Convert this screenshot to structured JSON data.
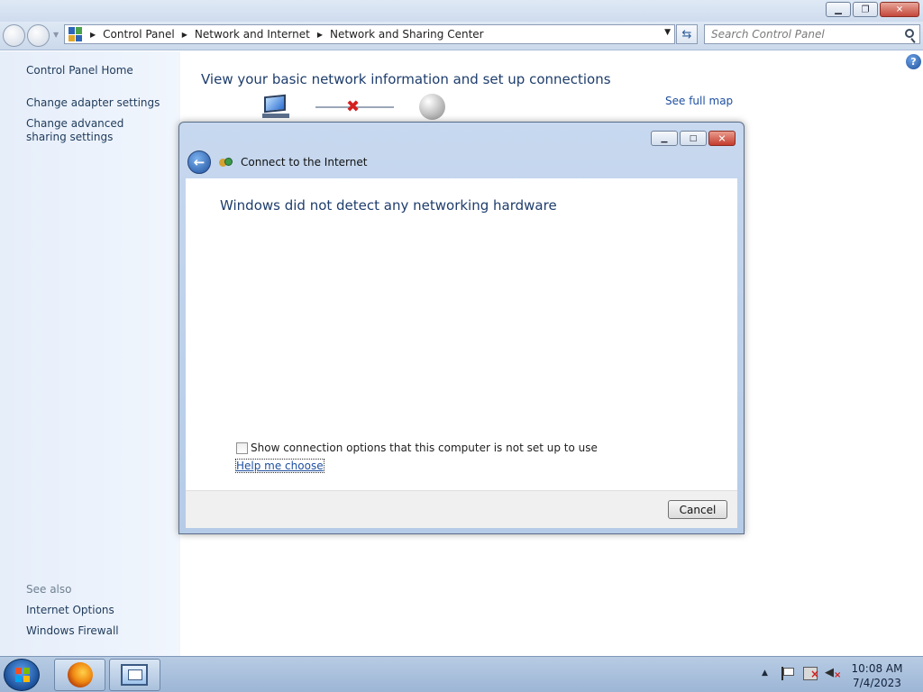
{
  "explorer": {
    "breadcrumb": [
      "Control Panel",
      "Network and Internet",
      "Network and Sharing Center"
    ],
    "search_placeholder": "Search Control Panel"
  },
  "left_pane": {
    "home": "Control Panel Home",
    "links": [
      "Change adapter settings",
      "Change advanced sharing settings"
    ],
    "see_also_label": "See also",
    "see_also": [
      "Internet Options",
      "Windows Firewall"
    ]
  },
  "main": {
    "title": "View your basic network information and set up connections",
    "full_map_link": "See full map",
    "map_icons": [
      "computer-icon",
      "disconnected-x-icon",
      "internet-globe-icon"
    ]
  },
  "dialog": {
    "title": "Connect to the Internet",
    "heading": "Windows did not detect any networking hardware",
    "checkbox_label": "Show connection options that this computer is not set up to use",
    "checkbox_checked": false,
    "help_link": "Help me choose",
    "cancel": "Cancel"
  },
  "taskbar": {
    "pinned_icons": [
      "firefox-icon",
      "control-panel-icon"
    ],
    "time": "10:08 AM",
    "date": "7/4/2023"
  },
  "colors": {
    "link": "#1e4fa0",
    "heading": "#1e3d6c",
    "close_red": "#c4473a"
  }
}
